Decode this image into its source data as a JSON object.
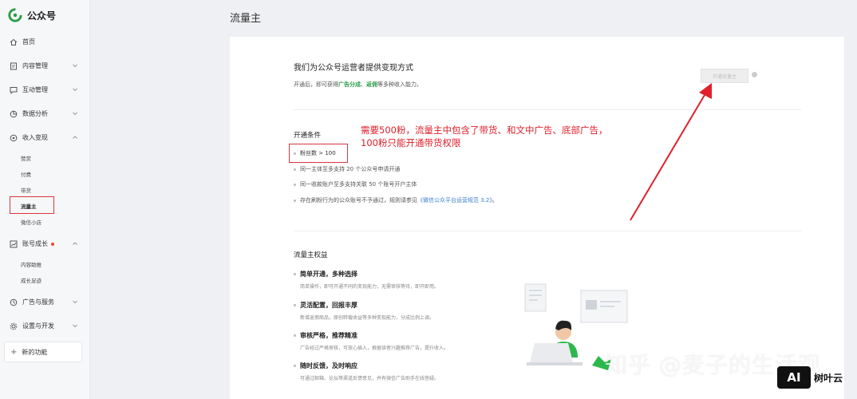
{
  "app": {
    "name": "公众号",
    "brand_color": "#2a9d47"
  },
  "sidebar": {
    "items": [
      {
        "label": "首页",
        "icon": "home-icon"
      },
      {
        "label": "内容管理",
        "icon": "document-icon"
      },
      {
        "label": "互动管理",
        "icon": "chat-icon"
      },
      {
        "label": "数据分析",
        "icon": "pie-chart-icon"
      },
      {
        "label": "收入变现",
        "icon": "income-icon"
      },
      {
        "label": "账号成长",
        "icon": "growth-icon"
      },
      {
        "label": "广告与服务",
        "icon": "ad-icon"
      },
      {
        "label": "设置与开发",
        "icon": "gear-icon"
      }
    ],
    "income_sub": [
      "赞赏",
      "付费",
      "带货",
      "流量主",
      "微信小店"
    ],
    "growth_sub": [
      "内容助推",
      "成长足迹"
    ],
    "new_features": "新的功能"
  },
  "page": {
    "title": "流量主"
  },
  "intro": {
    "heading": "我们为公众号运营者提供变现方式",
    "desc_prefix": "开通后，即可获得",
    "desc_hl1": "广告分成",
    "desc_sep": "、",
    "desc_hl2": "返佣",
    "desc_suffix": "等多种收入能力。",
    "open_button": "开通流量主"
  },
  "conditions": {
    "heading": "开通条件",
    "items": [
      "粉丝数 > 100",
      "同一主体至多支持 20 个公众号申请开通",
      "同一收款账户至多支持关联 50 个账号开户主体"
    ],
    "last_prefix": "存在刷粉行为的公众账号不予通过，规则请参见",
    "last_link": "《微信公众平台运营规范 3.2》",
    "last_suffix": "。"
  },
  "annotation": {
    "line1": "需要500粉，流量主中包含了带货、和文中广告、底部广告，",
    "line2": "100粉只能开通带货权限"
  },
  "benefits": {
    "heading": "流量主权益",
    "items": [
      {
        "title": "简单开通，多种选择",
        "desc": "简单操作，即可开通不同的变现能力，无需审核等待，即开即用。"
      },
      {
        "title": "灵活配置，回报丰厚",
        "desc": "新增返佣商品，原创转载收益等多种变现能力，分成比例上调。"
      },
      {
        "title": "审核严格，推荐精准",
        "desc": "广告经过严格审核，可放心插入，根据读者兴趣推荐广告，提升收入。"
      },
      {
        "title": "随时反馈，及时响应",
        "desc": "可通过邮箱、论坛等渠道反馈意见，并有微信广告助手在线答疑。"
      }
    ]
  },
  "watermark": "知乎 @麦子的生活观",
  "badge": {
    "logo": "AI",
    "name": "树叶云"
  },
  "colors": {
    "annotation": "#e0202b",
    "link": "#3b7fd0"
  }
}
